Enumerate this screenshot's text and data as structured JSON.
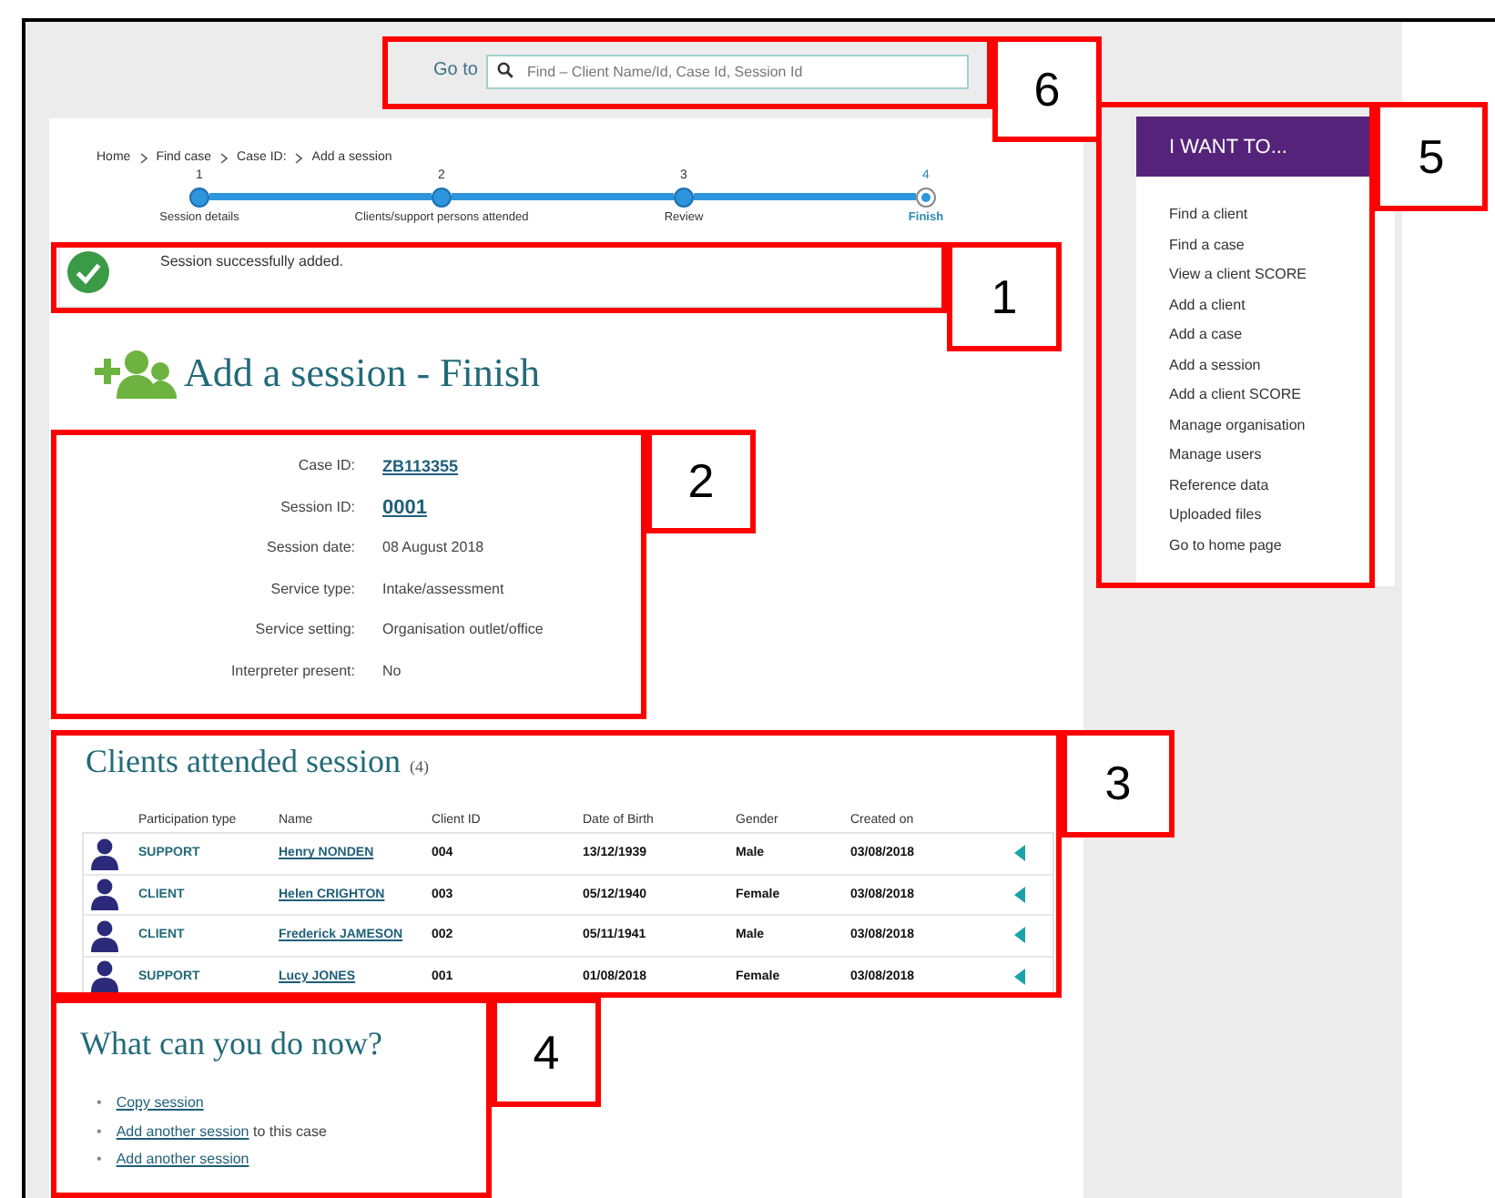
{
  "search": {
    "label": "Go to",
    "placeholder": "Find – Client Name/Id, Case Id, Session Id"
  },
  "breadcrumb": [
    "Home",
    "Find case",
    "Case ID:",
    "Add a session"
  ],
  "steps": [
    {
      "number": "1",
      "label": "Session details",
      "selected": false
    },
    {
      "number": "2",
      "label": "Clients/support persons attended",
      "selected": false
    },
    {
      "number": "3",
      "label": "Review",
      "selected": false
    },
    {
      "number": "4",
      "label": "Finish",
      "selected": true
    }
  ],
  "message": {
    "kind": "success",
    "text": "Session successfully added."
  },
  "page_title": "Add a session - Finish",
  "details": [
    {
      "label": "Case ID:",
      "value": "ZB113355",
      "kind": "link"
    },
    {
      "label": "Session ID:",
      "value": "0001",
      "kind": "id-link"
    },
    {
      "label": "Session date:",
      "value": "08 August 2018",
      "kind": "text"
    },
    {
      "label": "Service type:",
      "value": "Intake/assessment",
      "kind": "text"
    },
    {
      "label": "Service setting:",
      "value": "Organisation outlet/office",
      "kind": "text"
    },
    {
      "label": "Interpreter present:",
      "value": "No",
      "kind": "text"
    }
  ],
  "clients": {
    "title": "Clients attended session",
    "count": "(4)",
    "columns": [
      "Participation type",
      "Name",
      "Client ID",
      "Date of Birth",
      "Gender",
      "Created on"
    ],
    "rows": [
      {
        "type": "SUPPORT",
        "name": "Henry NONDEN",
        "id": "004",
        "dob": "13/12/1939",
        "gender": "Male",
        "created": "03/08/2018"
      },
      {
        "type": "CLIENT",
        "name": "Helen CRIGHTON",
        "id": "003",
        "dob": "05/12/1940",
        "gender": "Female",
        "created": "03/08/2018"
      },
      {
        "type": "CLIENT",
        "name": "Frederick JAMESON",
        "id": "002",
        "dob": "05/11/1941",
        "gender": "Male",
        "created": "03/08/2018"
      },
      {
        "type": "SUPPORT",
        "name": "Lucy JONES",
        "id": "001",
        "dob": "01/08/2018",
        "gender": "Female",
        "created": "03/08/2018"
      }
    ]
  },
  "next": {
    "title": "What can you do now?",
    "actions": [
      {
        "marker": "•",
        "link": "Copy session"
      },
      {
        "marker": "•",
        "link": "Add another session",
        "rest": " to this case"
      },
      {
        "marker": "•",
        "link": "Add another session"
      }
    ]
  },
  "sidebar": {
    "title": "I WANT TO...",
    "items": [
      "Find a client",
      "Find a case",
      "View a client SCORE",
      "Add a client",
      "Add a case",
      "Add a session",
      "Add a client SCORE",
      "Manage organisation",
      "Manage users",
      "Reference data",
      "Uploaded files",
      "Go to home page"
    ]
  },
  "callouts": [
    {
      "number": "6"
    },
    {
      "number": "1"
    },
    {
      "number": "2"
    },
    {
      "number": "3"
    },
    {
      "number": "4"
    },
    {
      "number": "5"
    }
  ]
}
